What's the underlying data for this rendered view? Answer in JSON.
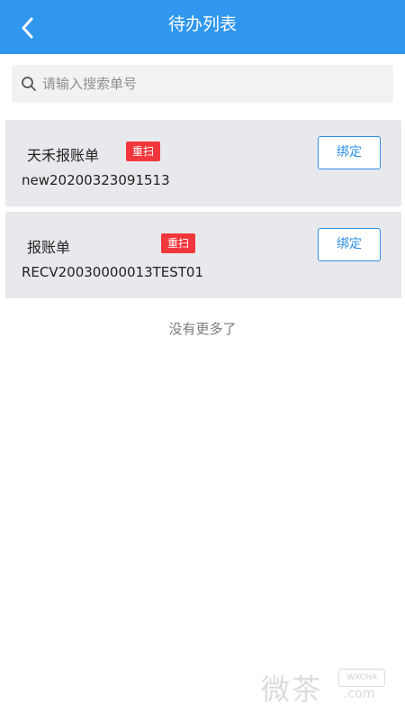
{
  "header": {
    "title": "待办列表",
    "back_icon": "chevron-left-icon",
    "color": "#2f97ee"
  },
  "search": {
    "placeholder": "请输入搜索单号",
    "value": "",
    "icon": "search-icon"
  },
  "items": [
    {
      "title": "天禾报账单",
      "badge": "重扫",
      "number": "new20200323091513",
      "button": "绑定"
    },
    {
      "title": "报账单",
      "badge": "重扫",
      "number": "RECV20030000013TEST01",
      "button": "绑定"
    }
  ],
  "footer_text": "没有更多了",
  "watermark": {
    "main": "微茶",
    "badge": "WXCHA",
    "domain": ".com"
  },
  "colors": {
    "accent": "#2f97ee",
    "badge": "#f2373c",
    "card_bg": "#e8e9ed"
  }
}
